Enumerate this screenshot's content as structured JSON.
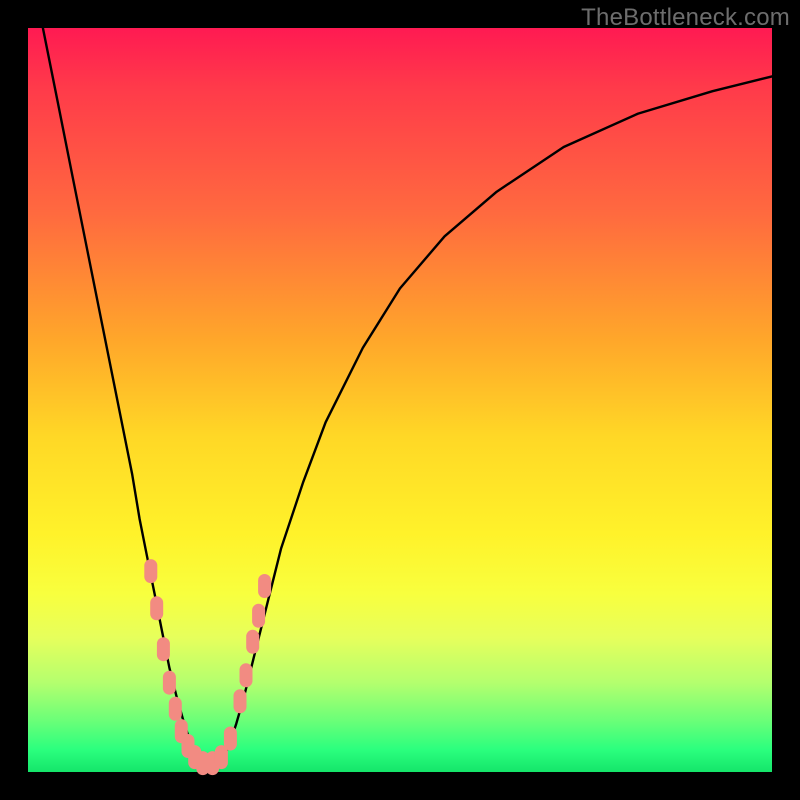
{
  "watermark": "TheBottleneck.com",
  "chart_data": {
    "type": "line",
    "title": "",
    "xlabel": "",
    "ylabel": "",
    "xlim": [
      0,
      100
    ],
    "ylim": [
      0,
      100
    ],
    "note": "Axes are unlabeled in the image; values below are positions estimated from pixel coordinates normalized to a 0–100 range. Two curves descend into a V-shaped minimum; salmon-colored pill markers cluster along the lower portion of both legs of the V.",
    "series": [
      {
        "name": "left-curve",
        "x": [
          2,
          4,
          6,
          8,
          10,
          12,
          14,
          15,
          16,
          17,
          18,
          19,
          20,
          21,
          22,
          22.7
        ],
        "y": [
          100,
          90,
          80,
          70,
          60,
          50,
          40,
          34,
          29,
          24,
          19,
          14,
          10,
          6.5,
          3.5,
          1.5
        ]
      },
      {
        "name": "right-curve",
        "x": [
          26,
          27,
          28,
          29,
          30,
          32,
          34,
          37,
          40,
          45,
          50,
          56,
          63,
          72,
          82,
          92,
          100
        ],
        "y": [
          1.5,
          3.5,
          6.5,
          10,
          14,
          22,
          30,
          39,
          47,
          57,
          65,
          72,
          78,
          84,
          88.5,
          91.5,
          93.5
        ]
      }
    ],
    "markers": {
      "name": "salmon-pills",
      "color": "#f28b82",
      "points": [
        {
          "x": 16.5,
          "y": 27
        },
        {
          "x": 17.3,
          "y": 22
        },
        {
          "x": 18.2,
          "y": 16.5
        },
        {
          "x": 19.0,
          "y": 12
        },
        {
          "x": 19.8,
          "y": 8.5
        },
        {
          "x": 20.6,
          "y": 5.5
        },
        {
          "x": 21.5,
          "y": 3.5
        },
        {
          "x": 22.4,
          "y": 2.0
        },
        {
          "x": 23.5,
          "y": 1.2
        },
        {
          "x": 24.8,
          "y": 1.2
        },
        {
          "x": 26.0,
          "y": 2.0
        },
        {
          "x": 27.2,
          "y": 4.5
        },
        {
          "x": 28.5,
          "y": 9.5
        },
        {
          "x": 29.3,
          "y": 13
        },
        {
          "x": 30.2,
          "y": 17.5
        },
        {
          "x": 31.0,
          "y": 21
        },
        {
          "x": 31.8,
          "y": 25
        }
      ]
    }
  }
}
